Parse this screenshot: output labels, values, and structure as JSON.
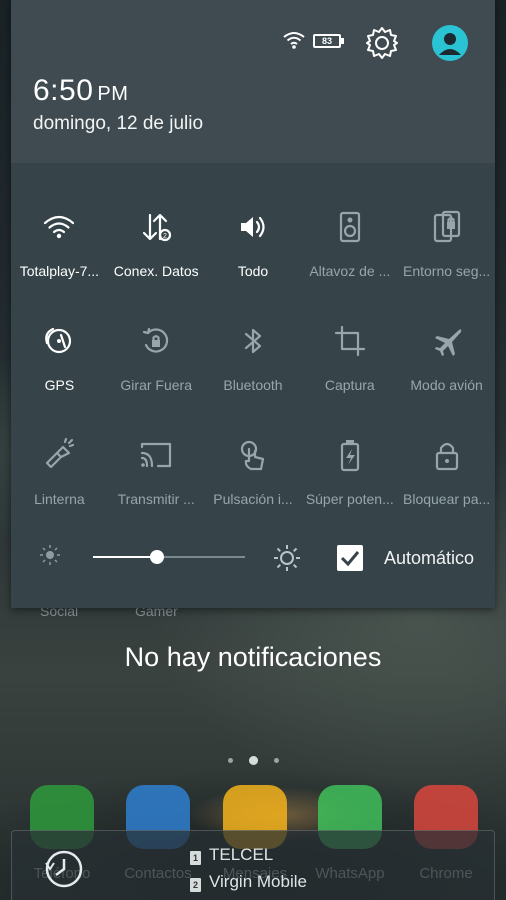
{
  "status": {
    "battery_level": "83"
  },
  "header": {
    "time": "6:50",
    "ampm": "PM",
    "date": "domingo, 12 de julio"
  },
  "tiles": [
    {
      "label": "Totalplay-7...",
      "icon": "wifi-icon",
      "on": true
    },
    {
      "label": "Conex. Datos",
      "icon": "data-arrows-icon",
      "on": true
    },
    {
      "label": "Todo",
      "icon": "volume-icon",
      "on": true
    },
    {
      "label": "Altavoz de ...",
      "icon": "speaker-icon",
      "on": false
    },
    {
      "label": "Entorno seg...",
      "icon": "secure-environment-icon",
      "on": false
    },
    {
      "label": "GPS",
      "icon": "gps-icon",
      "on": true
    },
    {
      "label": "Girar Fuera",
      "icon": "rotation-lock-icon",
      "on": false
    },
    {
      "label": "Bluetooth",
      "icon": "bluetooth-icon",
      "on": false
    },
    {
      "label": "Captura",
      "icon": "crop-icon",
      "on": false
    },
    {
      "label": "Modo avión",
      "icon": "airplane-icon",
      "on": false
    },
    {
      "label": "Linterna",
      "icon": "flashlight-icon",
      "on": false
    },
    {
      "label": "Transmitir ...",
      "icon": "cast-icon",
      "on": false
    },
    {
      "label": "Pulsación i...",
      "icon": "touch-icon",
      "on": false
    },
    {
      "label": "Súper poten...",
      "icon": "battery-saver-icon",
      "on": false
    },
    {
      "label": "Bloquear pa...",
      "icon": "lock-icon",
      "on": false
    }
  ],
  "brightness": {
    "level": 0.42,
    "auto_label": "Automático",
    "auto_checked": true
  },
  "background_labels": {
    "left": "Social",
    "right": "Gamer"
  },
  "notifications": {
    "empty_text": "No hay notificaciones"
  },
  "dock": [
    {
      "name": "Teléfono",
      "color": "#2e9a3c"
    },
    {
      "name": "Contactos",
      "color": "#2f7fd0"
    },
    {
      "name": "Mensajes",
      "color": "#f2b21c"
    },
    {
      "name": "WhatsApp",
      "color": "#3fbf5a"
    },
    {
      "name": "Chrome",
      "color": "#d9473d"
    }
  ],
  "carriers": [
    {
      "sim": "1",
      "name": "TELCEL"
    },
    {
      "sim": "2",
      "name": "Virgin Mobile"
    }
  ],
  "colors": {
    "accent": "#29c3d4",
    "panel": "#36444a",
    "header": "#3f4b50"
  }
}
